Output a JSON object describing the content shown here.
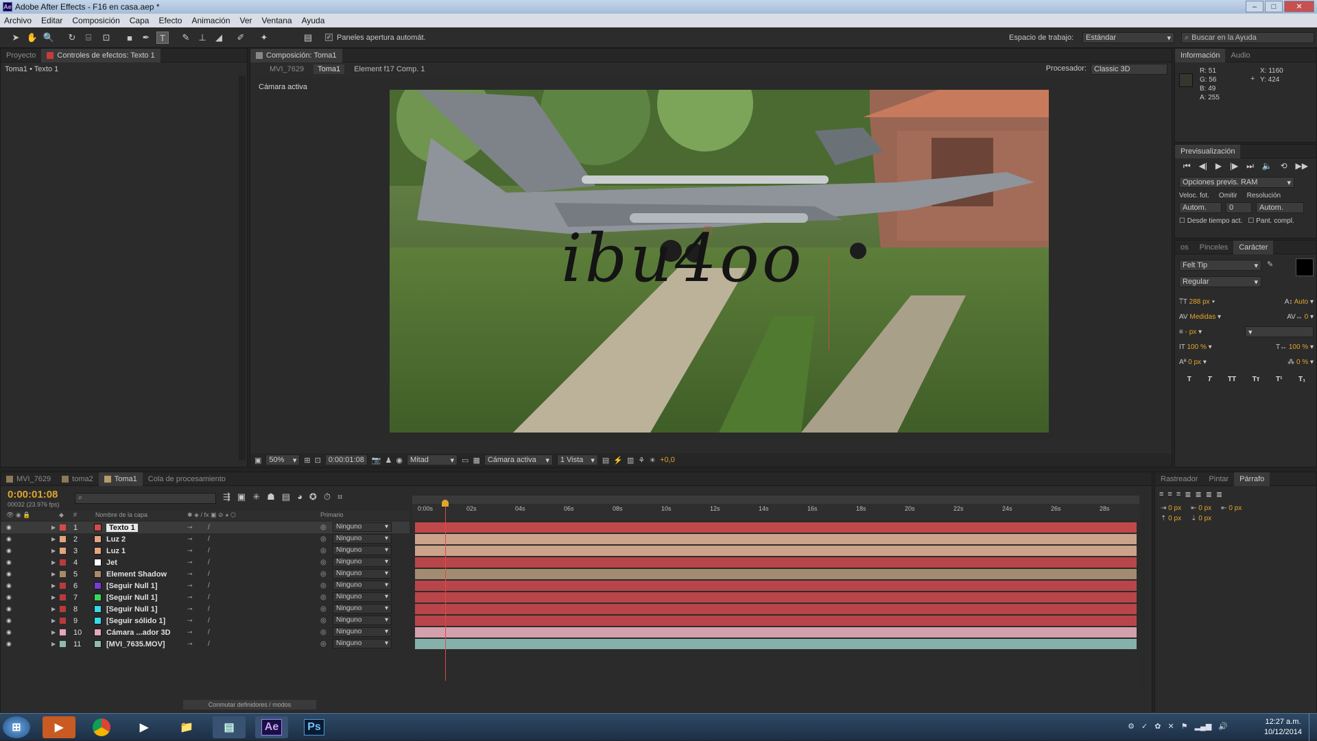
{
  "window": {
    "title": "Adobe After Effects - F16 en casa.aep *",
    "app_icon": "Ae"
  },
  "menu": [
    "Archivo",
    "Editar",
    "Composición",
    "Capa",
    "Efecto",
    "Animación",
    "Ver",
    "Ventana",
    "Ayuda"
  ],
  "toolbar": {
    "auto_open_label": "Paneles apertura automát.",
    "workspace_label": "Espacio de trabajo:",
    "workspace_value": "Estándar",
    "help_placeholder": "Buscar en la Ayuda"
  },
  "left_panel": {
    "tabs": [
      "Proyecto",
      "Controles de efectos: Texto 1"
    ],
    "breadcrumb": "Toma1 • Texto 1"
  },
  "comp": {
    "tab": "Composición: Toma1",
    "crumbs": [
      "MVI_7629",
      "Toma1",
      "Element f17 Comp. 1"
    ],
    "renderer_label": "Procesador:",
    "renderer_value": "Classic 3D",
    "camera_label": "Cámara activa",
    "overlay_text": "ibu4oo",
    "footer": {
      "zoom": "50%",
      "time": "0:00:01:08",
      "resolution": "Mitad",
      "view": "Cámara activa",
      "views": "1 Vista",
      "exposure": "+0,0"
    }
  },
  "info": {
    "tabs": [
      "Información",
      "Audio"
    ],
    "r": "R: 51",
    "g": "G: 56",
    "b": "B: 49",
    "a": "A: 255",
    "x": "X: 1160",
    "y": "Y: 424"
  },
  "preview": {
    "tab": "Previsualización",
    "ram_options": "Opciones previs. RAM",
    "frame_rate_label": "Veloc. fot.",
    "skip_label": "Omitir",
    "resolution_label": "Resolución",
    "frame_rate": "Autom.",
    "skip": "0",
    "resolution": "Autom.",
    "from_current": "Desde tiempo act.",
    "full_screen": "Pant. compl."
  },
  "character": {
    "tabs": [
      "os",
      "Pinceles",
      "Carácter"
    ],
    "font": "Felt Tip",
    "style": "Regular",
    "size": "288 px",
    "leading": "Auto",
    "kerning": "Medidas",
    "tracking": "0",
    "stroke": "- px",
    "vscale": "100 %",
    "hscale": "100 %",
    "baseline": "0 px",
    "tsume": "0 %",
    "format_buttons": [
      "T",
      "T",
      "TT",
      "Tт",
      "T¹",
      "T₁"
    ]
  },
  "paragraph": {
    "tabs": [
      "Rastreador",
      "Pintar",
      "Párrafo"
    ],
    "values": [
      "0 px",
      "0 px",
      "0 px",
      "0 px",
      "0 px"
    ]
  },
  "timeline": {
    "tabs": [
      "MVI_7629",
      "toma2",
      "Toma1",
      "Cola de procesamiento"
    ],
    "timecode": "0:00:01:08",
    "fps": "00032 (23.976 fps)",
    "col_layer_name": "Nombre de la capa",
    "col_parent": "Primario",
    "ruler": [
      "0:00s",
      "02s",
      "04s",
      "06s",
      "08s",
      "10s",
      "12s",
      "14s",
      "16s",
      "18s",
      "20s",
      "22s",
      "24s",
      "26s",
      "28s"
    ],
    "layers": [
      {
        "num": "1",
        "name": "Texto 1",
        "icon": "T",
        "color": "#d54a4a",
        "parent": "Ninguno",
        "bar": "#c0484a"
      },
      {
        "num": "2",
        "name": "Luz 2",
        "icon": "💡",
        "color": "#e3a57d",
        "parent": "Ninguno",
        "bar": "#caa38a"
      },
      {
        "num": "3",
        "name": "Luz 1",
        "icon": "💡",
        "color": "#e3a57d",
        "parent": "Ninguno",
        "bar": "#caa38a"
      },
      {
        "num": "4",
        "name": "Jet",
        "icon": "■",
        "color": "#b93a3a",
        "parent": "Ninguno",
        "bar": "#b8454a"
      },
      {
        "num": "5",
        "name": "Element Shadow",
        "icon": "▣",
        "color": "#a88a6a",
        "parent": "Ninguno",
        "bar": "#a38b70"
      },
      {
        "num": "6",
        "name": "[Seguir Null 1]",
        "icon": "■",
        "color": "#b93a3a",
        "parent": "Ninguno",
        "bar": "#b8454a"
      },
      {
        "num": "7",
        "name": "[Seguir Null 1]",
        "icon": "■",
        "color": "#b93a3a",
        "parent": "Ninguno",
        "bar": "#b8454a"
      },
      {
        "num": "8",
        "name": "[Seguir Null 1]",
        "icon": "■",
        "color": "#b93a3a",
        "parent": "Ninguno",
        "bar": "#b8454a"
      },
      {
        "num": "9",
        "name": "[Seguir sólido 1]",
        "icon": "■",
        "color": "#b93a3a",
        "parent": "Ninguno",
        "bar": "#b8454a"
      },
      {
        "num": "10",
        "name": "Cámara ...ador 3D",
        "icon": "▭",
        "color": "#e6a8b8",
        "parent": "Ninguno",
        "bar": "#d4a0ac"
      },
      {
        "num": "11",
        "name": "[MVI_7635.MOV]",
        "icon": "▶",
        "color": "#8fbab0",
        "parent": "Ninguno",
        "bar": "#86b0aa"
      }
    ],
    "layer_swatches": [
      "#d54a4a",
      "#e3a57d",
      "#e3a57d",
      "#ffffff",
      "#a88a6a",
      "#7a3ad8",
      "#3ad85a",
      "#3ad8e8",
      "#3ad8e8",
      "#e6a8b8",
      "#8fbab0"
    ],
    "toggle_label": "Conmutar definidores / modos"
  },
  "taskbar": {
    "time": "12:27 a.m.",
    "date": "10/12/2014",
    "apps": [
      "start",
      "media",
      "chrome",
      "player",
      "explorer",
      "files",
      "Ae",
      "Ps"
    ]
  }
}
